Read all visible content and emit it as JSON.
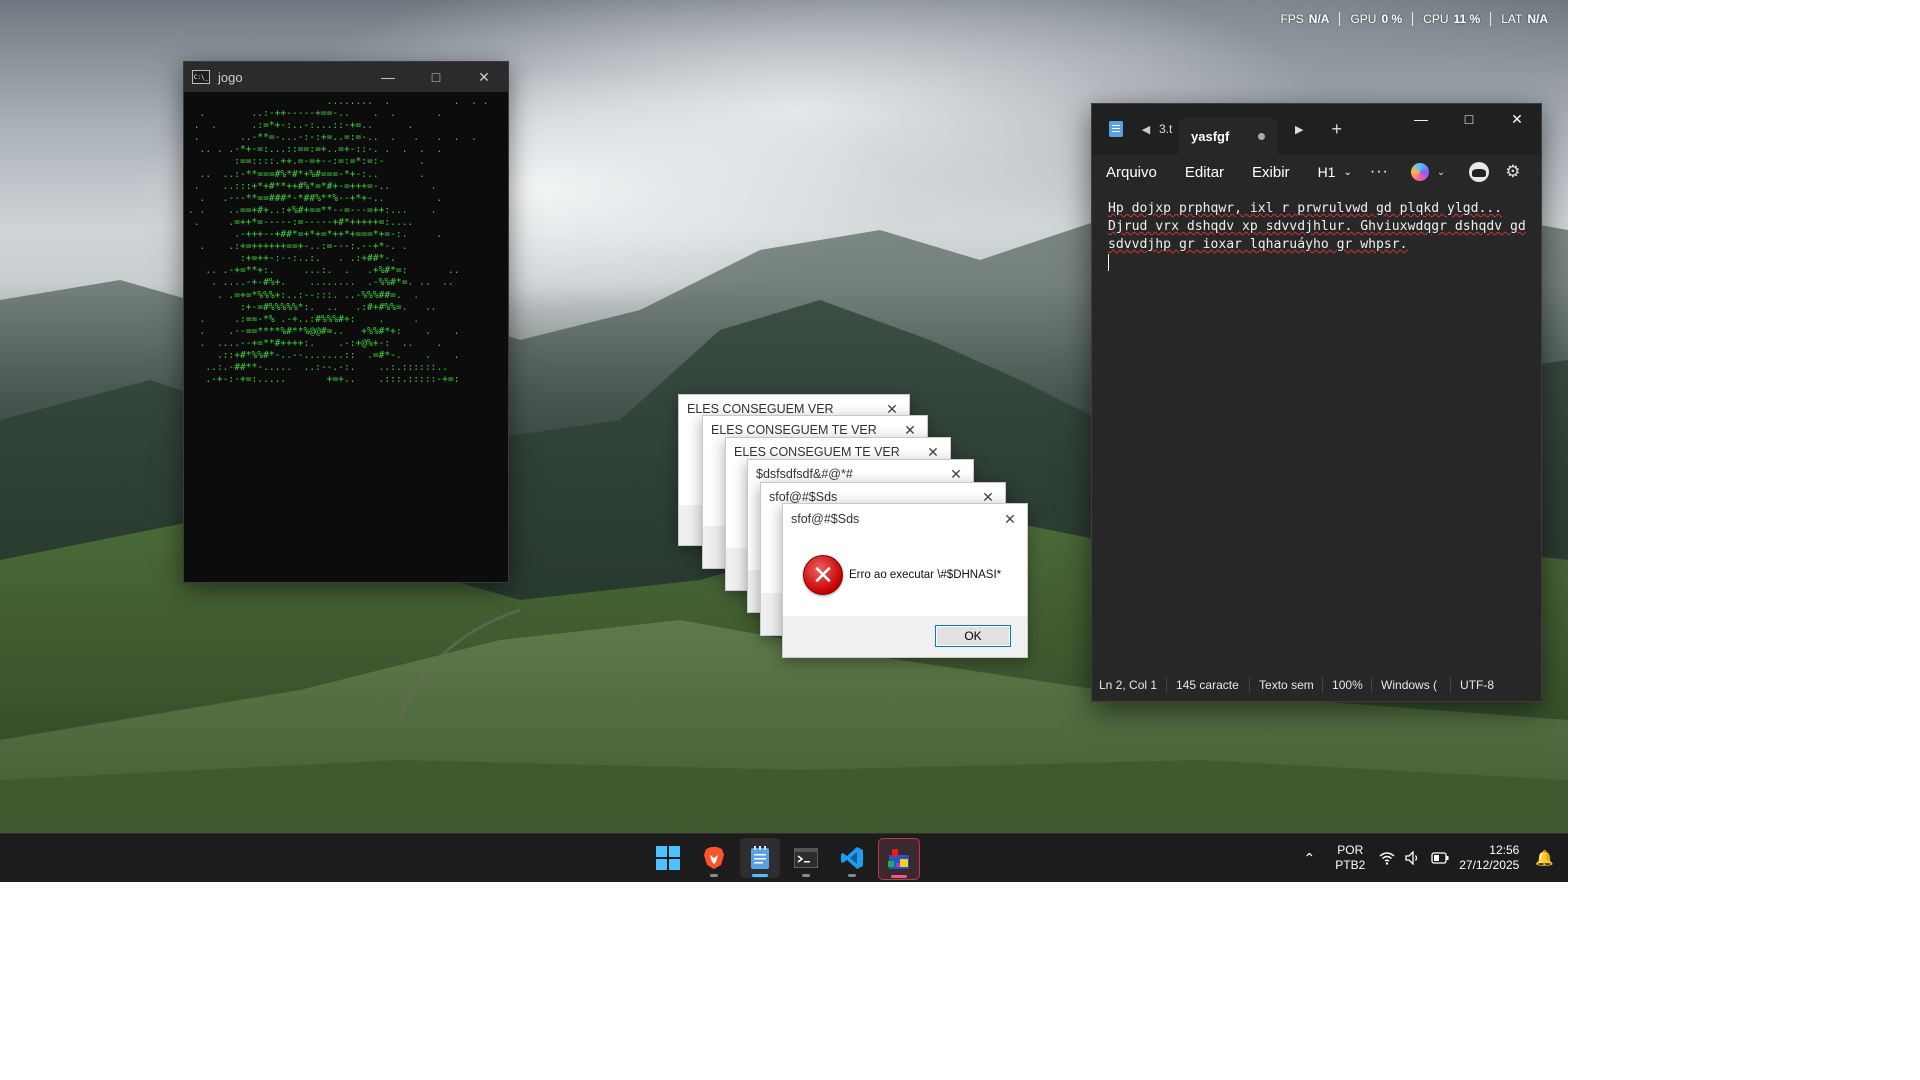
{
  "perf_overlay": [
    {
      "label": "FPS",
      "value": "N/A"
    },
    {
      "label": "GPU",
      "value": "0 %"
    },
    {
      "label": "CPU",
      "value": "11 %"
    },
    {
      "label": "LAT",
      "value": "N/A"
    }
  ],
  "console": {
    "title": "jogo",
    "icon_text": "C:\\_",
    "ascii": "                        ........  .           .  . .\n  .        ..:-++-----+==-..    .  .       .\n .  .      .:=*+-:..-:...::-+=..      .\n .       ..-**=-...-:-:+=..=:=-..  .   .   .  .  .\n  .. . .-*+-=:...::==:=+..=+-::-. .  .  .  .\n        :==::::.++.=-=+--:=:=*:=:-      .\n  ..  ..:-**===#%*#*+%#===-*+-:..       .\n .    ..:::+*+#**++#%*=*#+-=+++=-..       .\n  .   .---**==###*-*##%**%--+*+-..         .\n. .    ..==+#+..:+%#+==**--=---=++:...    .\n .     .=++*=-----:=-----+#*+++++=:....\n        .-+++--+##*=+*+=*++*+===*+=-:.     .\n  .    .:+=++++++==+-..:=---:.--+*-. .\n         :+=++-:--:..:.   . .:+##*-.\n   .. .-+=**+:.     ...:.  .   .+%#*=:       ..\n    . ....-+-#%+.    ........  .-%%#*=. ..  ..\n     . .=+=*%%%+:..:--:::. ..-%%%##=.  .\n         :+-=#%%%%%*:.  ..   .:#+#%%=.   ..\n  .     .:==-*% .-+..:#%%%#+:    .     .\n  .    .--==****%#**%@@#=..   +%%#*+:    .    .\n  .  ....--+=**#++++:.    .-:+@%+-:  ..    .\n     .::+#*%%#*-..--.......::  .=#*-.    .    .\n   ..:.-##**-.....  ..:--.-:.    ..:.::::::..\n   .-+-:-+=:.....       +=+..    .:::.:::::-+=:"
  },
  "notepad": {
    "prev_tab_fragment": "3.t",
    "tab_title": "yasfgf",
    "menu": [
      "Arquivo",
      "Editar",
      "Exibir"
    ],
    "heading_selector": "H1",
    "more_label": "···",
    "lines": [
      "Hp dojxp prphqwr, ixl r prwrulvwd gd plqkd ylgd...",
      "Djrud vrx dshqdv xp sdvvdjhlur. Ghviuxwdqgr dshqdv gd",
      "sdvvdjhp gr ioxar lqharuáyho gr whpsr."
    ],
    "status": [
      "Ln 2, Col 1",
      "145 caracte",
      "Texto sem",
      "100%",
      "Windows (",
      "UTF-8"
    ]
  },
  "dialogs": [
    {
      "title": "ELES CONSEGUEM VER"
    },
    {
      "title": "ELES CONSEGUEM TE VER"
    },
    {
      "title": "ELES CONSEGUEM TE VER"
    },
    {
      "title": "$dsfsdfsdf&#@*#"
    },
    {
      "title": "sfof@#$Sds"
    },
    {
      "title": "sfof@#$Sds",
      "message": "Erro ao executar \\#$DHNASI*",
      "ok": "OK"
    }
  ],
  "taskbar": {
    "apps": [
      "start",
      "brave",
      "notepad",
      "terminal",
      "vscode",
      "game"
    ],
    "lang_line1": "POR",
    "lang_line2": "PTB2",
    "time": "12:56",
    "date": "27/12/2025"
  },
  "colors": {
    "console_text": "#3fd03f",
    "accent": "#4cc2ff",
    "error_red": "#c40000"
  }
}
